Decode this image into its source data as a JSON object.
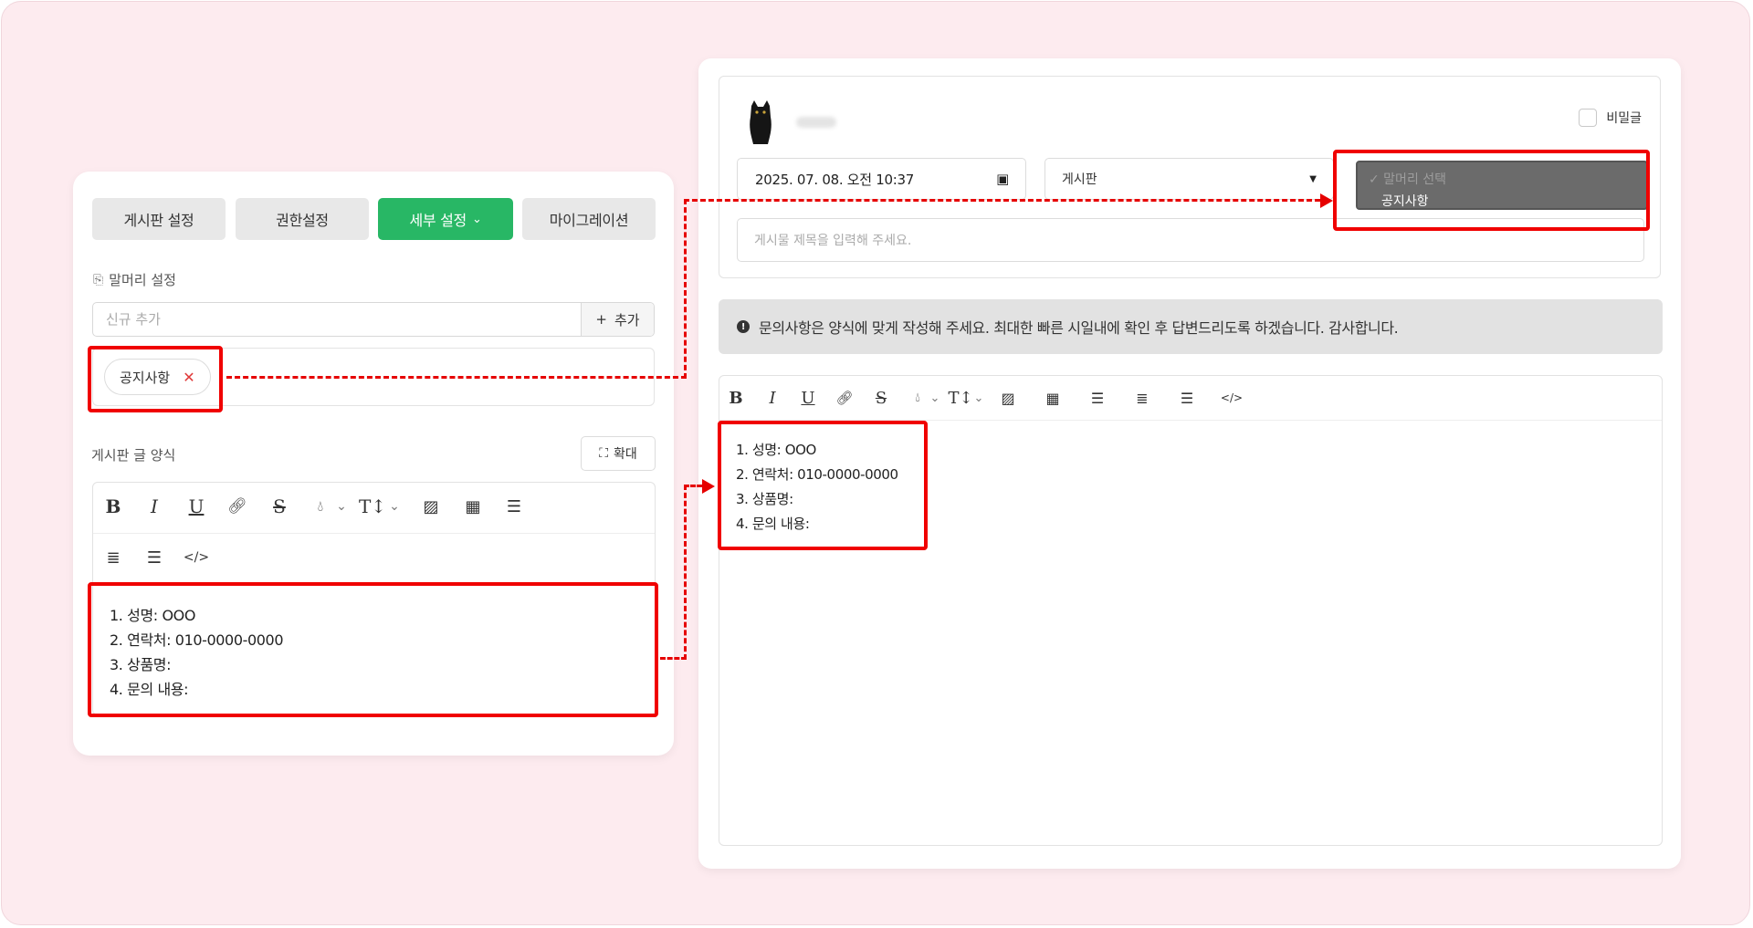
{
  "left_panel": {
    "tabs": [
      {
        "label": "게시판 설정"
      },
      {
        "label": "권한설정"
      },
      {
        "label": "세부 설정",
        "chevron": "chevron-down-icon"
      },
      {
        "label": "마이그레이션"
      }
    ],
    "prefix_section_title": "말머리 설정",
    "new_input_placeholder": "신규 추가",
    "add_button_label": "추가",
    "tag_chip_label": "공지사항",
    "form_title": "게시판 글 양식",
    "expand_button_label": "확대",
    "template_lines": [
      "1. 성명: OOO",
      "2. 연락처: 010-0000-0000",
      "3. 상품명:",
      "4. 문의 내용:"
    ]
  },
  "right_panel": {
    "secret_label": "비밀글",
    "date_value": "2025. 07. 08. 오전 10:37",
    "board_select_value": "게시판",
    "prefix_dropdown": {
      "placeholder_option": "✓ 말머리 선택",
      "option": "공지사항"
    },
    "title_placeholder": "게시물 제목을 입력해 주세요.",
    "notice_text": "문의사항은 양식에 맞게 작성해 주세요. 최대한 빠른 시일내에 확인 후 답변드리도록 하겠습니다. 감사합니다.",
    "editor_lines": [
      "1. 성명: OOO",
      "2. 연락처: 010-0000-0000",
      "3. 상품명:",
      "4. 문의 내용:"
    ]
  },
  "colors": {
    "accent_green": "#28b765",
    "highlight_red": "#f00000",
    "background_pink": "#fdebef"
  }
}
